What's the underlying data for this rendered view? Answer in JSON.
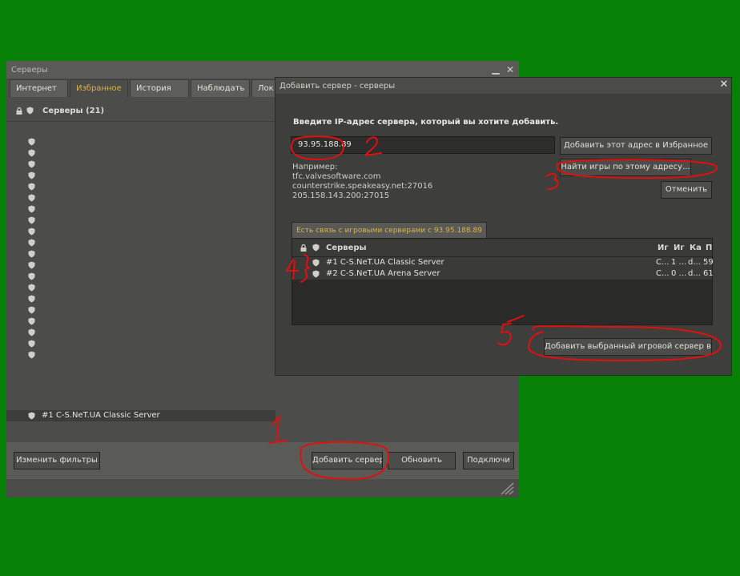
{
  "main": {
    "title": "Серверы",
    "tabs": [
      {
        "label": "Интернет"
      },
      {
        "label": "Избранное"
      },
      {
        "label": "История"
      },
      {
        "label": "Наблюдать"
      },
      {
        "label": "Лок"
      }
    ],
    "list_header": "Серверы (21)",
    "selected_row": "#1 C-S.NeT.UA Classic Server",
    "buttons": {
      "change_filters": "Изменить фильтры",
      "add_server": "Добавить сервер",
      "refresh": "Обновить",
      "connect": "Подключи"
    }
  },
  "dialog": {
    "title": "Добавить сервер - серверы",
    "prompt": "Введите IP-адрес сервера, который вы хотите добавить.",
    "ip_value": "93.95.188.89",
    "examples_label": "Например:",
    "examples": [
      "tfc.valvesoftware.com",
      "counterstrike.speakeasy.net:27016",
      "205.158.143.200:27015"
    ],
    "buttons": {
      "add_address": "Добавить этот адрес в Избранное",
      "find_games": "Найти игры по этому адресу...",
      "cancel": "Отменить",
      "add_selected": "Добавить выбранный игровой сервер в И"
    },
    "result_tab": "Есть связь с игровыми серверами с 93.95.188.89",
    "columns": [
      "Серверы",
      "Иг",
      "Иг",
      "Ка",
      "П"
    ],
    "rows": [
      {
        "name": "#1 C-S.NeT.UA Classic Server",
        "c1": "C...",
        "c2": "1 ...",
        "c3": "d...",
        "c4": "59"
      },
      {
        "name": "#2 C-S.NeT.UA Arena Server",
        "c1": "C...",
        "c2": "0 ...",
        "c3": "d...",
        "c4": "61"
      }
    ]
  },
  "annotations": [
    "1",
    "2",
    "3",
    "4",
    "5"
  ],
  "colors": {
    "background": "#078007",
    "accent_tab": "#d8b44a",
    "annotation": "#e01010"
  }
}
